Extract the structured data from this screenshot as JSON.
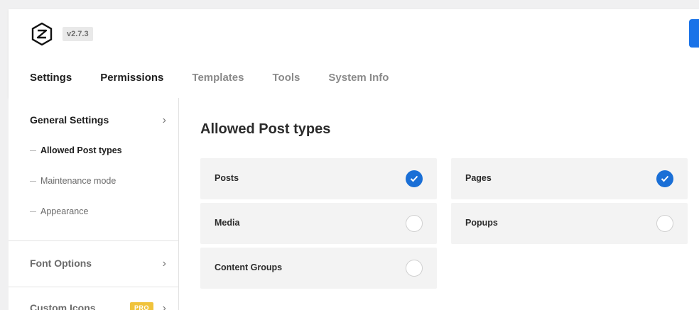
{
  "header": {
    "version": "v2.7.3",
    "tabs": [
      {
        "label": "Settings",
        "active": true
      },
      {
        "label": "Permissions",
        "active": true
      },
      {
        "label": "Templates",
        "active": false
      },
      {
        "label": "Tools",
        "active": false
      },
      {
        "label": "System Info",
        "active": false
      }
    ]
  },
  "sidebar": {
    "general": {
      "label": "General Settings"
    },
    "subitems": [
      {
        "label": "Allowed Post types",
        "active": true
      },
      {
        "label": "Maintenance mode",
        "active": false
      },
      {
        "label": "Appearance",
        "active": false
      }
    ],
    "font_options": {
      "label": "Font Options"
    },
    "custom_icons": {
      "label": "Custom Icons",
      "badge": "PRO"
    }
  },
  "main": {
    "title": "Allowed Post types",
    "post_types": [
      {
        "label": "Posts",
        "checked": true
      },
      {
        "label": "Pages",
        "checked": true
      },
      {
        "label": "Media",
        "checked": false
      },
      {
        "label": "Popups",
        "checked": false
      },
      {
        "label": "Content Groups",
        "checked": false
      }
    ]
  },
  "colors": {
    "accent": "#1a6fd6",
    "pro_badge": "#f0c33c",
    "card_bg": "#f3f3f3"
  }
}
